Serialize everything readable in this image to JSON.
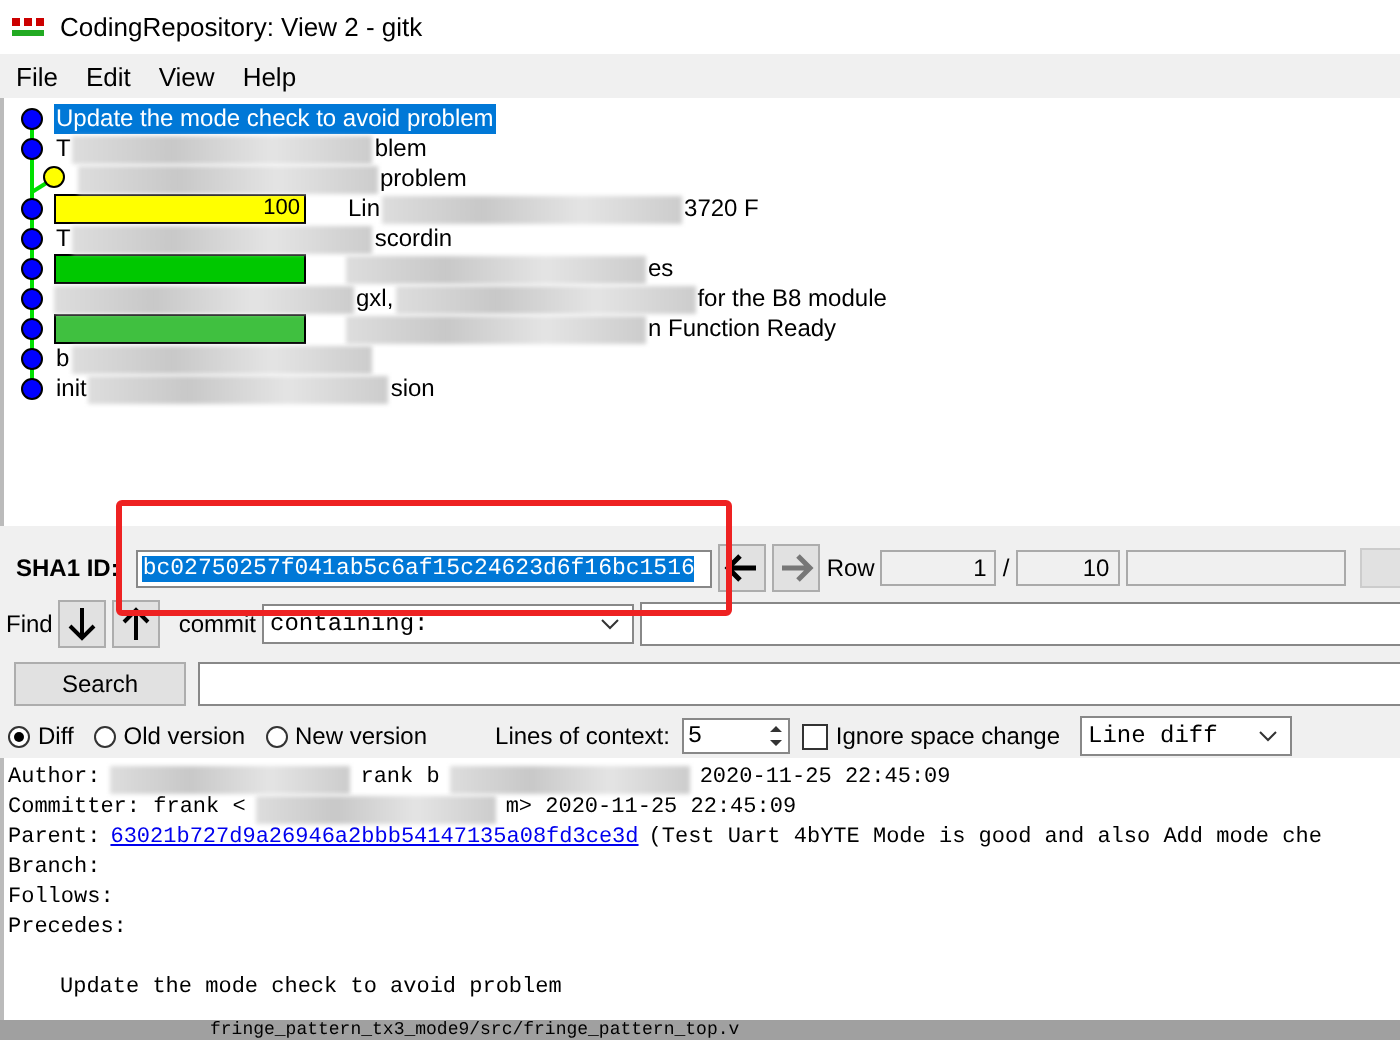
{
  "window": {
    "title": "CodingRepository: View 2 - gitk"
  },
  "menu": [
    "File",
    "Edit",
    "View",
    "Help"
  ],
  "commits": [
    {
      "kind": "main",
      "selected": true,
      "segments": [
        {
          "kind": "text",
          "text": "Update the mode check to avoid problem"
        }
      ]
    },
    {
      "kind": "main",
      "selected": false,
      "segments": [
        {
          "kind": "text",
          "text": "T"
        },
        {
          "kind": "blur"
        },
        {
          "kind": "text",
          "text": "blem"
        }
      ]
    },
    {
      "kind": "side",
      "selected": false,
      "segments": [
        {
          "kind": "blur"
        },
        {
          "kind": "text",
          "text": "problem"
        }
      ]
    },
    {
      "kind": "main",
      "selected": false,
      "tag": {
        "color": "#ffff00",
        "text": "100"
      },
      "segments": [
        {
          "kind": "text",
          "text": "Lin"
        },
        {
          "kind": "blur"
        },
        {
          "kind": "text",
          "text": "3720 F"
        }
      ]
    },
    {
      "kind": "main",
      "selected": false,
      "segments": [
        {
          "kind": "text",
          "text": "T"
        },
        {
          "kind": "blur"
        },
        {
          "kind": "text",
          "text": "scordin"
        }
      ]
    },
    {
      "kind": "main",
      "selected": false,
      "tag": {
        "color": "#00c800"
      },
      "segments": [
        {
          "kind": "blur"
        },
        {
          "kind": "text",
          "text": "es"
        }
      ]
    },
    {
      "kind": "main",
      "selected": false,
      "segments": [
        {
          "kind": "blur"
        },
        {
          "kind": "text",
          "text": "gxl,"
        },
        {
          "kind": "blur"
        },
        {
          "kind": "text",
          "text": "for the B8 module"
        }
      ]
    },
    {
      "kind": "main",
      "selected": false,
      "tag": {
        "color": "#40c040"
      },
      "segments": [
        {
          "kind": "blur"
        },
        {
          "kind": "text",
          "text": "n Function Ready"
        }
      ]
    },
    {
      "kind": "main",
      "selected": false,
      "segments": [
        {
          "kind": "text",
          "text": "b"
        },
        {
          "kind": "blur"
        }
      ]
    },
    {
      "kind": "main",
      "selected": false,
      "segments": [
        {
          "kind": "text",
          "text": "init"
        },
        {
          "kind": "blur"
        },
        {
          "kind": "text",
          "text": "sion"
        }
      ]
    }
  ],
  "sha": {
    "label": "SHA1 ID:",
    "value": "bc02750257f041ab5c6af15c24623d6f16bc1516",
    "row_label": "Row",
    "row": "1",
    "sep": "/",
    "total": "10"
  },
  "find": {
    "label": "Find",
    "type_label": "commit",
    "mode": "containing:"
  },
  "search_button": "Search",
  "diff_options": {
    "modes": [
      {
        "label": "Diff",
        "selected": true
      },
      {
        "label": "Old version",
        "selected": false
      },
      {
        "label": "New version",
        "selected": false
      }
    ],
    "context_label": "Lines of context:",
    "context": "5",
    "ignore_label": "Ignore space change",
    "ignore_checked": false,
    "diff_type": "Line diff"
  },
  "details": [
    {
      "kind": "plain",
      "segments": [
        {
          "kind": "text",
          "text": "Author:"
        },
        {
          "kind": "blur"
        },
        {
          "kind": "text",
          "text": "rank b"
        },
        {
          "kind": "blur"
        },
        {
          "kind": "text",
          "text": "2020-11-25 22:45:09"
        }
      ]
    },
    {
      "kind": "plain",
      "segments": [
        {
          "kind": "text",
          "text": "Committer: frank <"
        },
        {
          "kind": "blur"
        },
        {
          "kind": "text",
          "text": "m>  2020-11-25 22:45:09"
        }
      ]
    },
    {
      "kind": "parent",
      "label": "Parent:",
      "link": "63021b727d9a26946a2bbb54147135a08fd3ce3d",
      "text": "(Test Uart 4bYTE Mode is good and also Add mode che"
    },
    {
      "kind": "plain",
      "segments": [
        {
          "kind": "text",
          "text": "Branch:"
        }
      ]
    },
    {
      "kind": "plain",
      "segments": [
        {
          "kind": "text",
          "text": "Follows:"
        }
      ]
    },
    {
      "kind": "plain",
      "segments": [
        {
          "kind": "text",
          "text": "Precedes:"
        }
      ]
    },
    {
      "kind": "blank"
    },
    {
      "kind": "message",
      "text": "Update the mode check to avoid problem"
    }
  ],
  "file_header": "fringe_pattern_tx3_mode9/src/fringe_pattern_top.v"
}
